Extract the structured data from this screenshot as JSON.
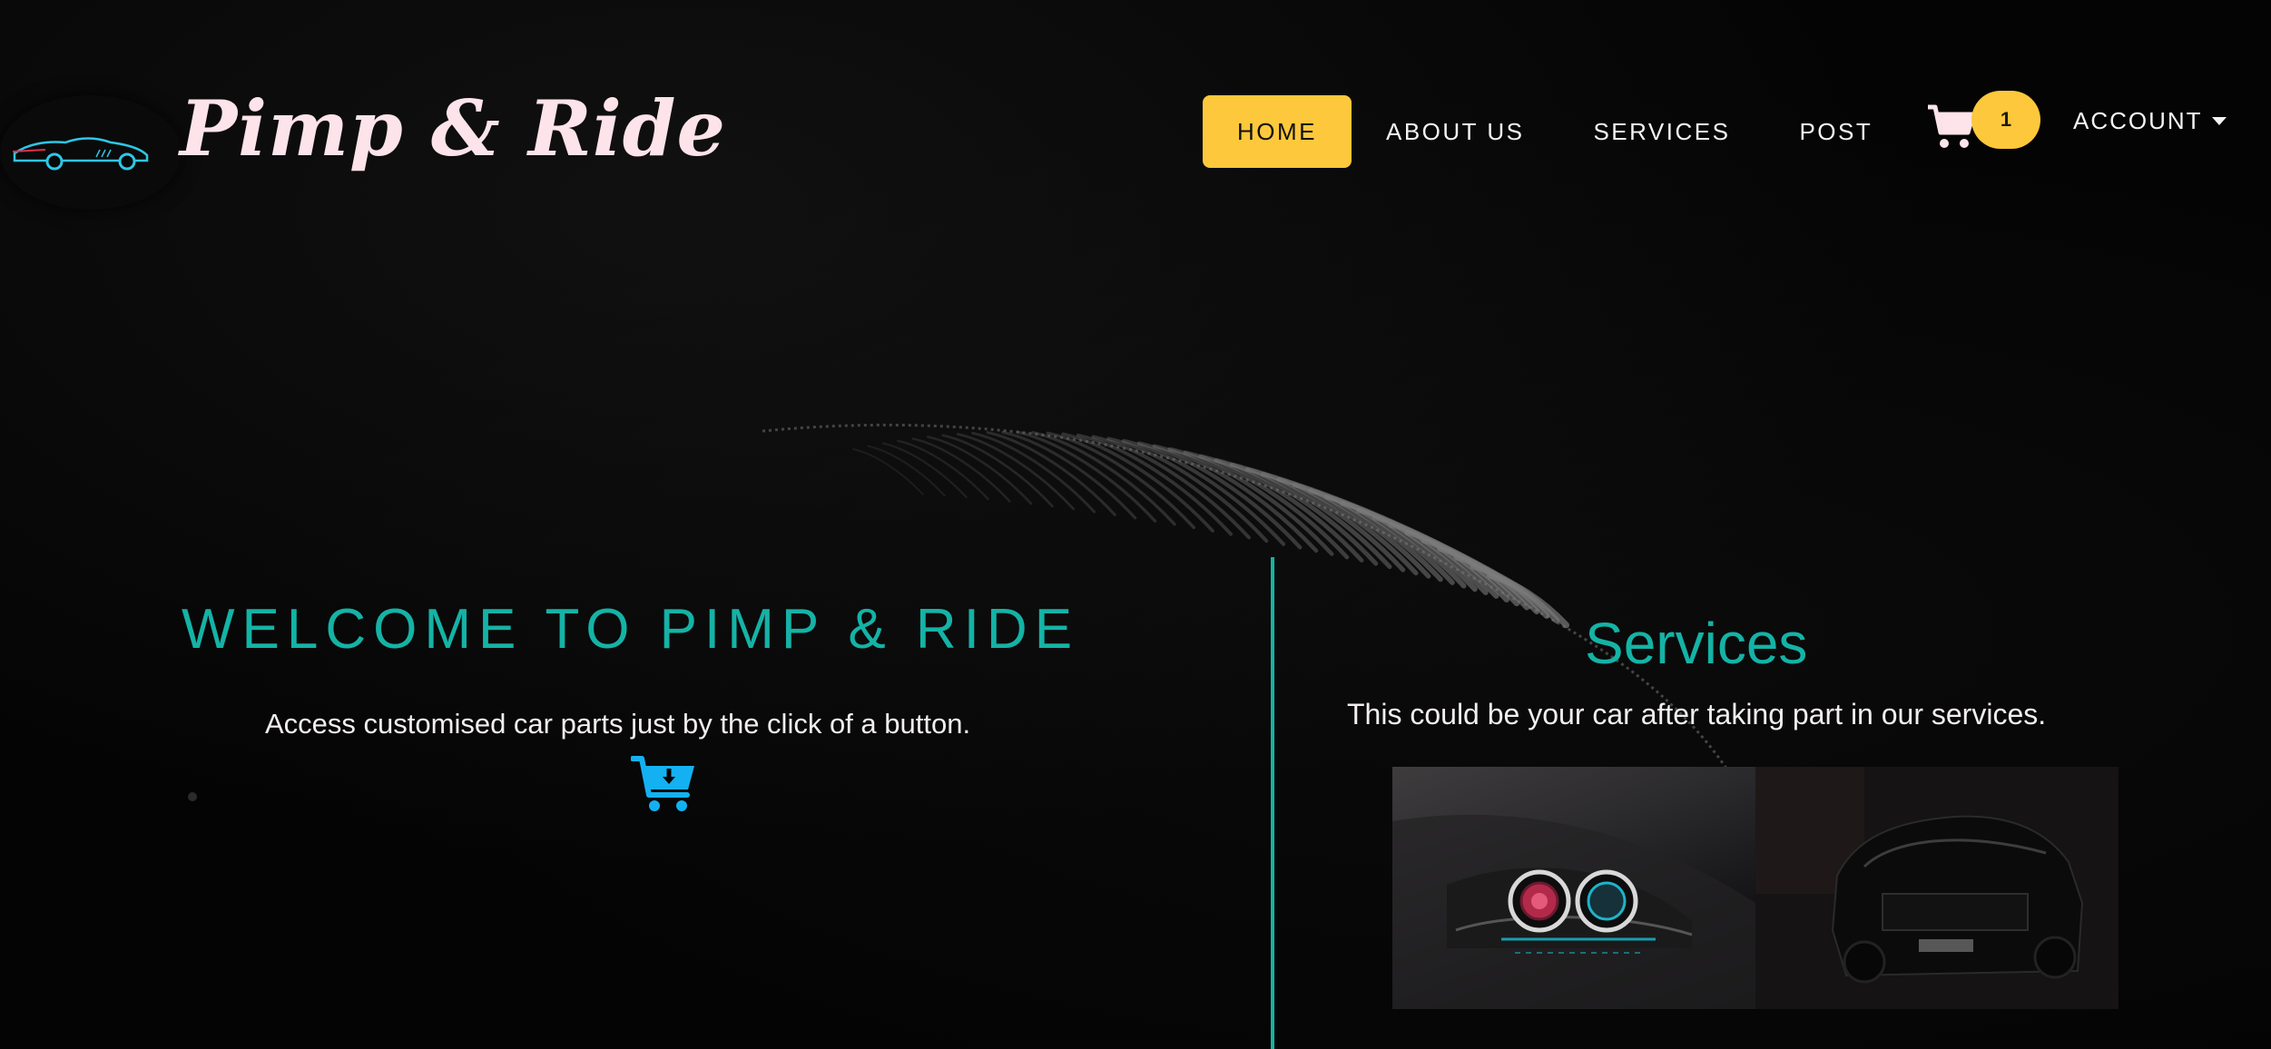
{
  "header": {
    "brand": "Pimp & Ride",
    "nav": [
      {
        "label": "HOME",
        "active": true
      },
      {
        "label": "ABOUT US",
        "active": false
      },
      {
        "label": "SERVICES",
        "active": false
      },
      {
        "label": "POST",
        "active": false
      }
    ],
    "cart_count": "1",
    "account_label": "ACCOUNT",
    "icons": {
      "logo": "car-logo-icon",
      "cart": "shopping-cart-icon",
      "account_caret": "caret-down-icon"
    }
  },
  "hero": {
    "title": "WELCOME TO PIMP & RIDE",
    "subtitle": "Access customised car parts just by the click of a button.",
    "cart_icon": "cart-download-icon"
  },
  "services": {
    "title": "Services",
    "text": "This could be your car after taking part in our services.",
    "photos": [
      {
        "name": "car-headlights-photo"
      },
      {
        "name": "black-suv-photo"
      }
    ]
  },
  "colors": {
    "accent": "#14b3a6",
    "nav_active": "#fdc83b",
    "brand_text": "#fde3ea",
    "background": "#040404",
    "icon_blue": "#13b1f1"
  }
}
